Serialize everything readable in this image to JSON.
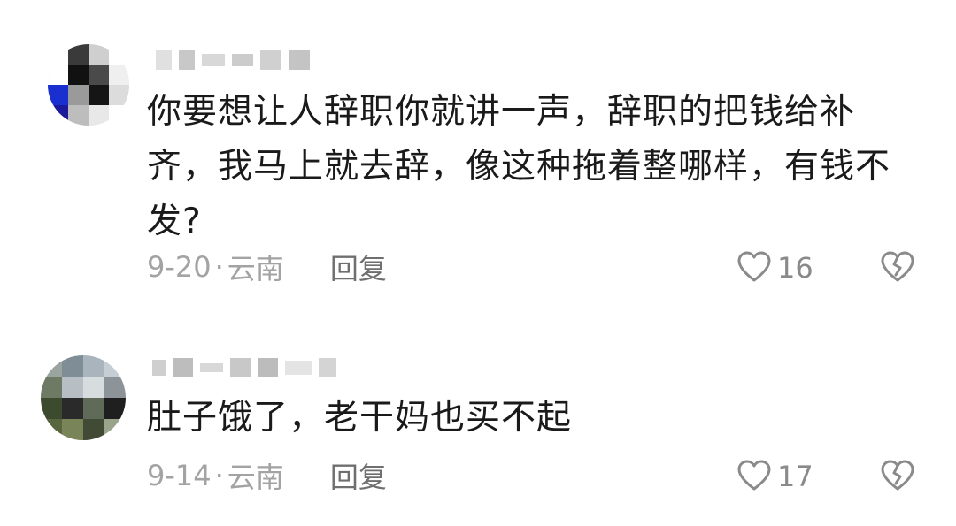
{
  "comments": [
    {
      "text": "你要想让人辞职你就讲一声，辞职的把钱给补齐，我马上就去辞，像这种拖着整哪样，有钱不发?",
      "date": "9-20",
      "separator": "·",
      "location": "云南",
      "reply_label": "回复",
      "like_count": "16",
      "avatar": "blurred-avatar-icon"
    },
    {
      "text": "肚子饿了，老干妈也买不起",
      "date": "9-14",
      "separator": "·",
      "location": "云南",
      "reply_label": "回复",
      "like_count": "17",
      "avatar": "blurred-avatar-icon"
    }
  ],
  "icons": {
    "like": "heart-outline-icon",
    "dislike": "broken-heart-icon"
  },
  "colors": {
    "text": "#1a1a1a",
    "meta": "#a3a3a3",
    "reply": "#6f6f6f",
    "icon": "#8a8a8a"
  }
}
